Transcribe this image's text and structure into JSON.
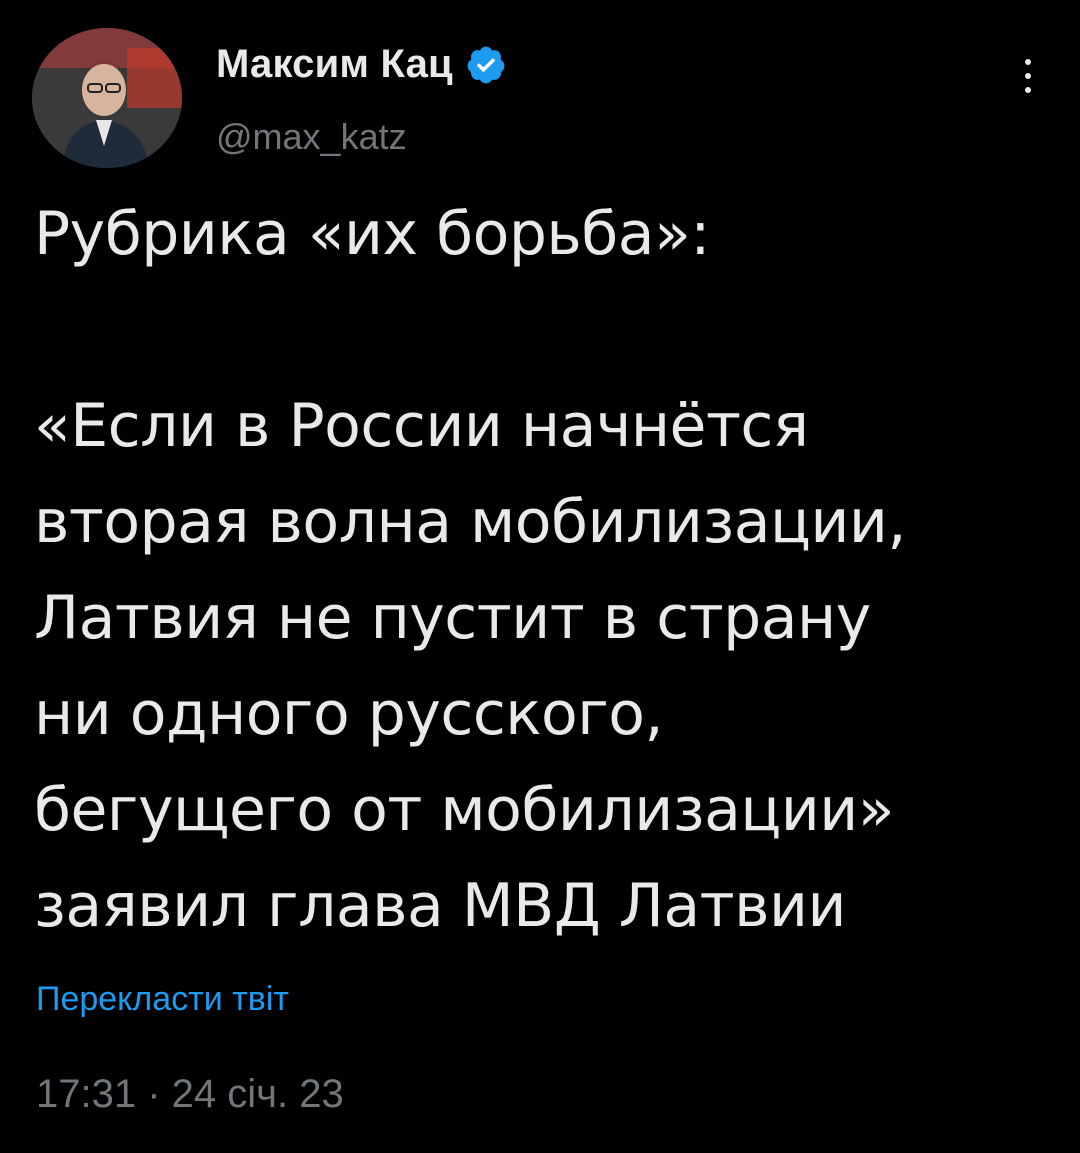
{
  "author": {
    "display_name": "Максим Кац",
    "handle": "@max_katz",
    "verified": true,
    "verified_color": "#1d9bf0"
  },
  "tweet": {
    "lines": [
      "Рубрика «их борьба»:",
      "",
      "«Если в России начнётся",
      "вторая волна мобилизации,",
      "Латвия не пустит в страну",
      "ни одного русского,",
      "бегущего от мобилизации»",
      "заявил глава МВД Латвии"
    ],
    "translate_label": "Перекласти твіт",
    "timestamp": "17:31 · 24 січ. 23"
  },
  "icons": {
    "more": "more-vertical-icon",
    "verified": "verified-badge-icon",
    "avatar": "avatar"
  },
  "colors": {
    "background": "#000000",
    "text": "#e7e9ea",
    "secondary": "#71767b",
    "link": "#1d9bf0"
  }
}
